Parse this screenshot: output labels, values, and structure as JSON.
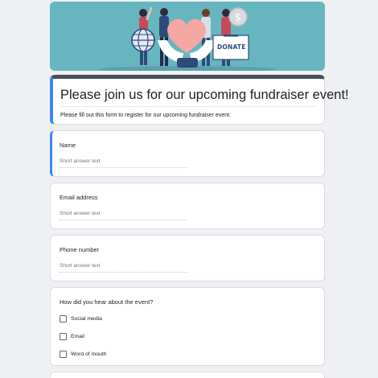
{
  "form": {
    "title": "Please join us for our upcoming fundraiser event!",
    "description": "Please fill out this form to register for our upcoming fundraiser event.",
    "banner_sign": "DONATE",
    "questions": [
      {
        "label": "Name",
        "placeholder": "Short answer text"
      },
      {
        "label": "Email address",
        "placeholder": "Short answer text"
      },
      {
        "label": "Phone number",
        "placeholder": "Short answer text"
      }
    ],
    "checkbox_question": {
      "label": "How did you hear about the event?",
      "options": [
        "Social media",
        "Email",
        "Word of mouth"
      ]
    }
  },
  "colors": {
    "background": "#eef0f3",
    "banner": "#67b6bf",
    "accent_blue": "#4285f4",
    "header_bar": "#444f57",
    "heart": "#f4a7a3"
  },
  "icons": [
    "globe-icon",
    "heart-icon",
    "coin-icon",
    "donation-box-icon"
  ]
}
